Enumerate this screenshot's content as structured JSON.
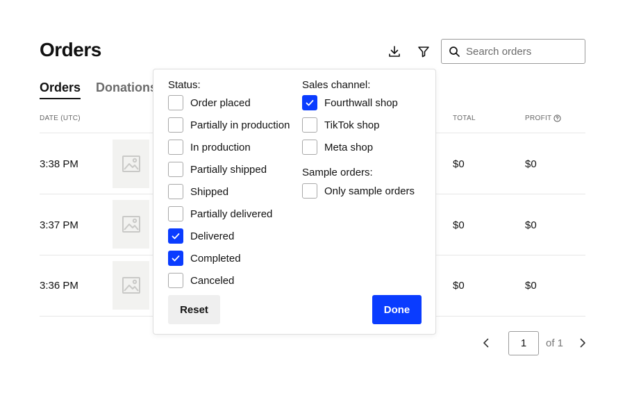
{
  "header": {
    "title": "Orders",
    "search_placeholder": "Search orders"
  },
  "tabs": [
    {
      "label": "Orders",
      "active": true
    },
    {
      "label": "Donations",
      "active": false
    }
  ],
  "table": {
    "columns": {
      "date": "DATE (UTC)",
      "total": "TOTAL",
      "profit": "PROFIT"
    },
    "rows": [
      {
        "time": "3:38 PM",
        "total": "$0",
        "profit": "$0"
      },
      {
        "time": "3:37 PM",
        "total": "$0",
        "profit": "$0"
      },
      {
        "time": "3:36 PM",
        "total": "$0",
        "profit": "$0"
      }
    ]
  },
  "pagination": {
    "current": "1",
    "of_label": "of 1"
  },
  "filter": {
    "status_label": "Status:",
    "status_options": [
      {
        "label": "Order placed",
        "checked": false
      },
      {
        "label": "Partially in production",
        "checked": false
      },
      {
        "label": "In production",
        "checked": false
      },
      {
        "label": "Partially shipped",
        "checked": false
      },
      {
        "label": "Shipped",
        "checked": false
      },
      {
        "label": "Partially delivered",
        "checked": false
      },
      {
        "label": "Delivered",
        "checked": true
      },
      {
        "label": "Completed",
        "checked": true
      },
      {
        "label": "Canceled",
        "checked": false
      }
    ],
    "sales_channel_label": "Sales channel:",
    "sales_channel_options": [
      {
        "label": "Fourthwall shop",
        "checked": true
      },
      {
        "label": "TikTok shop",
        "checked": false
      },
      {
        "label": "Meta shop",
        "checked": false
      }
    ],
    "sample_orders_label": "Sample orders:",
    "sample_options": [
      {
        "label": "Only sample orders",
        "checked": false
      }
    ],
    "reset_label": "Reset",
    "done_label": "Done"
  },
  "colors": {
    "accent": "#0a3cff",
    "thumb_bg": "#f2f2f0"
  },
  "icons": {
    "download": "download-icon",
    "filter": "filter-icon",
    "search": "search-icon",
    "info": "question-circle-icon",
    "image_placeholder": "image-placeholder-icon",
    "prev": "chevron-left-icon",
    "next": "chevron-right-icon",
    "check": "checkmark-icon"
  }
}
